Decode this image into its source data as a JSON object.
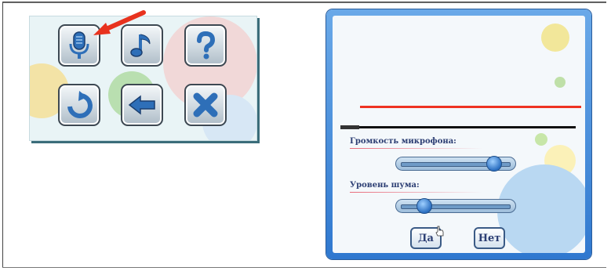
{
  "left_menu": {
    "icons": [
      {
        "name": "microphone-icon"
      },
      {
        "name": "music-note-icon"
      },
      {
        "name": "help-icon"
      },
      {
        "name": "undo-icon"
      },
      {
        "name": "back-arrow-icon"
      },
      {
        "name": "close-icon"
      }
    ],
    "highlight_arrow_color": "#e8321e"
  },
  "dialog": {
    "mic_volume_label": "Громкость микрофона:",
    "noise_level_label": "Уровень шума:",
    "mic_volume_value": 0.85,
    "noise_level_value": 0.2,
    "level_meter_value": 0.08,
    "yes_label": "Да",
    "no_label": "Нет"
  },
  "colors": {
    "accent_red": "#ee3322",
    "dialog_frame": "#3a82d6",
    "text_blue": "#2c3e73"
  }
}
